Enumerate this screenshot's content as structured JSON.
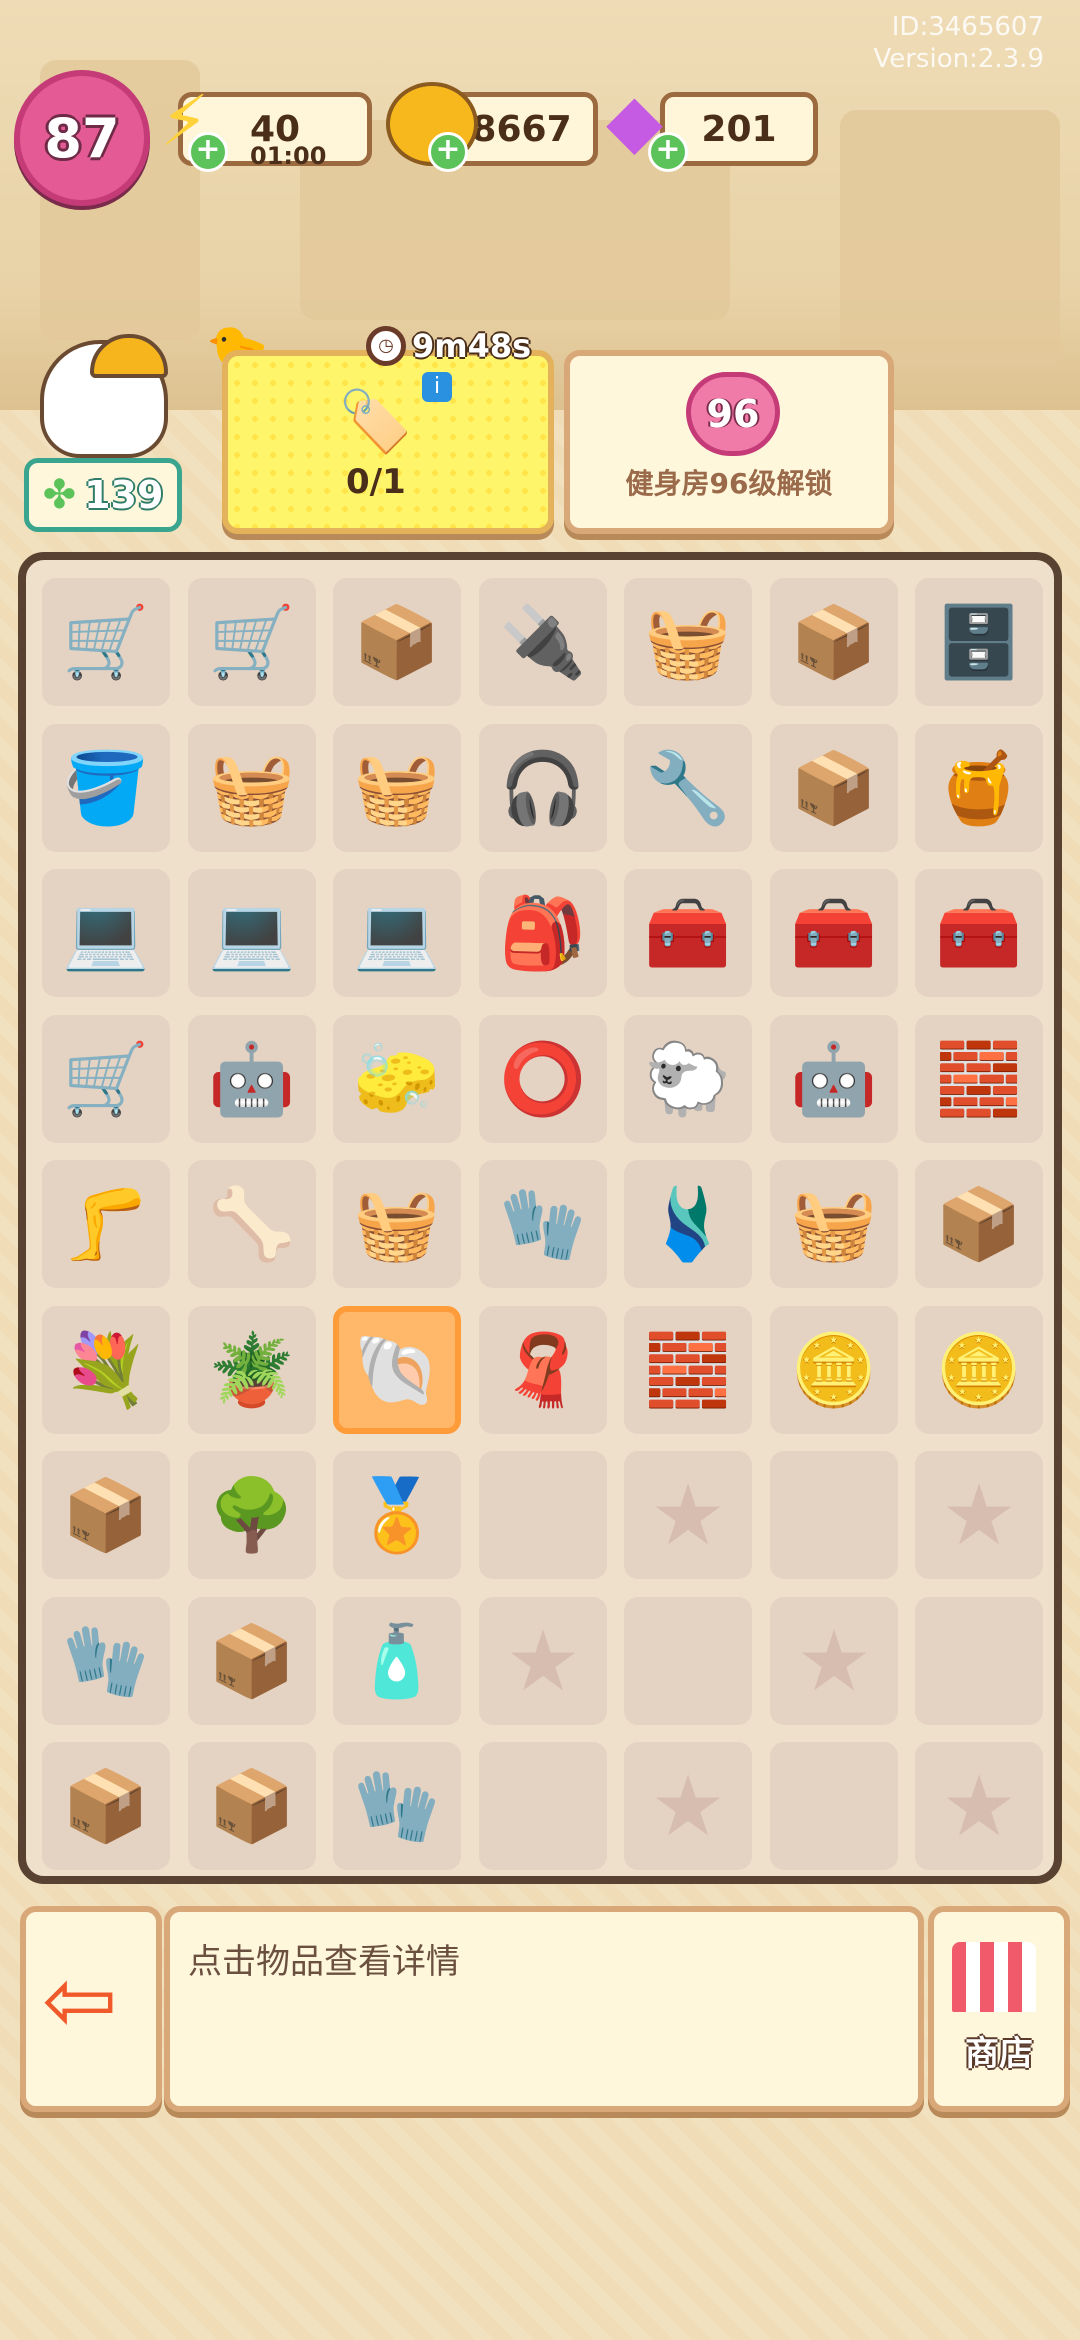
{
  "meta": {
    "id": "ID:3465607",
    "version": "Version:2.3.9"
  },
  "hud": {
    "level": "87",
    "energy": {
      "value": "40",
      "timer": "01:00",
      "icon": "lightning-icon"
    },
    "coins": {
      "value": "38667",
      "icon": "coin-icon"
    },
    "gems": {
      "value": "201",
      "icon": "gem-icon"
    },
    "clover_count": "139"
  },
  "quest": {
    "timer": "9m48s",
    "progress": "0/1",
    "info_icon": "info-icon"
  },
  "unlock": {
    "level": "96",
    "text": "健身房96级解锁"
  },
  "grid": {
    "columns": 7,
    "rows": [
      [
        "🛒",
        "🛒",
        "📦",
        "🔌",
        "🧺",
        "📦",
        "🗄️"
      ],
      [
        "🪣",
        "🧺",
        "🧺",
        "🎧",
        "🔧",
        "📦",
        "🍯"
      ],
      [
        "💻",
        "💻",
        "💻",
        "🎒",
        "🧰",
        "🧰",
        "🧰"
      ],
      [
        "🛒",
        "🤖",
        "🧽",
        "⭕",
        "🐑",
        "🤖",
        "🧱"
      ],
      [
        "🦵",
        "🦴",
        "🧺",
        "🧤",
        "🩱",
        "🧺",
        "📦"
      ],
      [
        "💐",
        "🪴",
        "🐚",
        "🧣",
        "🧱",
        "🪙",
        "🪙"
      ],
      [
        "📦",
        "🌳",
        "🏅",
        "",
        "★",
        "",
        "★"
      ],
      [
        "🧤",
        "📦",
        "🧴",
        "★",
        "",
        "★",
        ""
      ],
      [
        "📦",
        "📦",
        "🧤",
        "",
        "★",
        "",
        "★"
      ]
    ],
    "selected": "5-2"
  },
  "bottom": {
    "info_text": "点击物品查看详情",
    "shop_label": "商店",
    "exit_icon": "exit-door-icon"
  }
}
